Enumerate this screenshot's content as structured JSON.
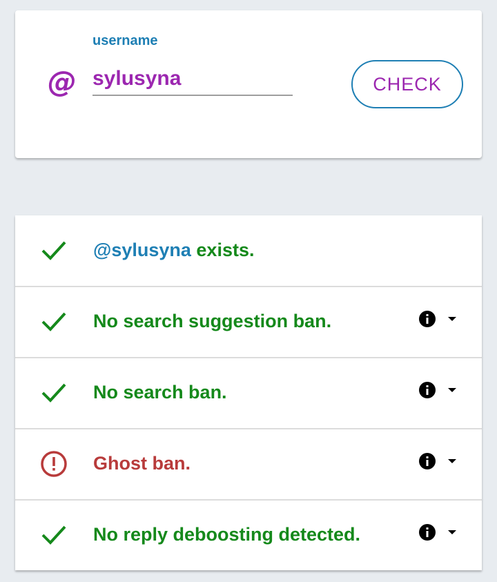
{
  "search": {
    "at_symbol": "@",
    "field_label": "username",
    "username_value": "sylusyna",
    "check_label": "CHECK"
  },
  "results": [
    {
      "status": "ok",
      "icon": "checkmark-icon",
      "username": "@sylusyna",
      "text": " exists.",
      "has_info": false
    },
    {
      "status": "ok",
      "icon": "checkmark-icon",
      "text": "No search suggestion ban.",
      "has_info": true
    },
    {
      "status": "ok",
      "icon": "checkmark-icon",
      "text": "No search ban.",
      "has_info": true
    },
    {
      "status": "warning",
      "icon": "alert-circle-icon",
      "text": "Ghost ban.",
      "has_info": true
    },
    {
      "status": "ok",
      "icon": "checkmark-icon",
      "text": "No reply deboosting detected.",
      "has_info": true
    }
  ],
  "colors": {
    "accent_purple": "#9c27b0",
    "accent_blue": "#1e7fb4",
    "ok_green": "#15891b",
    "warning_red": "#b83b3b",
    "background": "#e8ecf0"
  }
}
